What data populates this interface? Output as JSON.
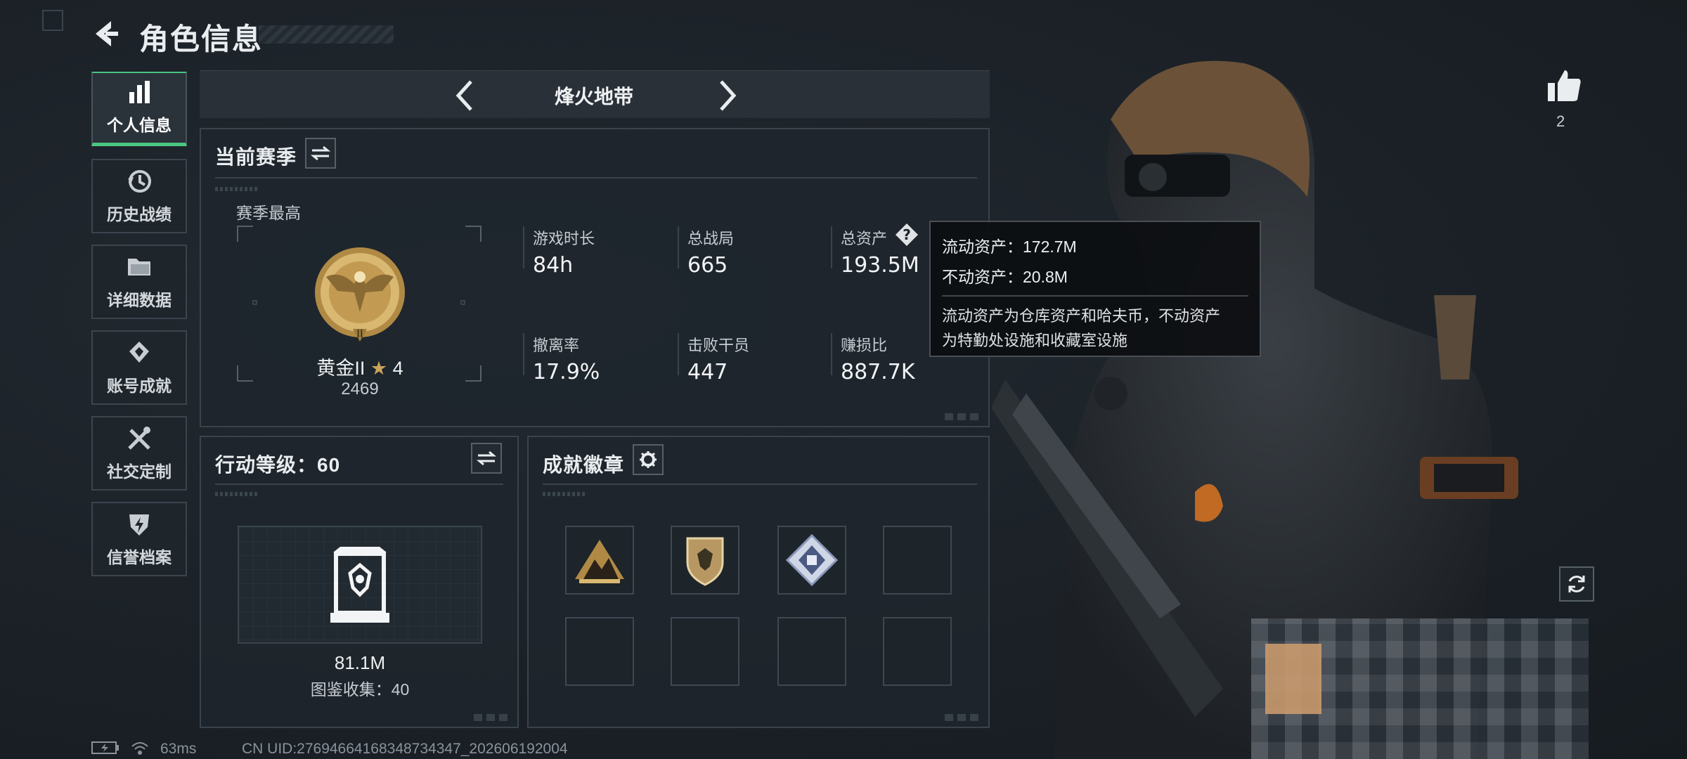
{
  "header": {
    "title": "角色信息"
  },
  "sidebar": {
    "items": [
      {
        "label": "个人信息",
        "icon": "bar-chart-icon",
        "active": true
      },
      {
        "label": "历史战绩",
        "icon": "history-clock-icon",
        "active": false
      },
      {
        "label": "详细数据",
        "icon": "folder-icon",
        "active": false
      },
      {
        "label": "账号成就",
        "icon": "achievement-icon",
        "active": false
      },
      {
        "label": "社交定制",
        "icon": "wrench-screwdriver-icon",
        "active": false
      },
      {
        "label": "信誉档案",
        "icon": "shield-lightning-icon",
        "active": false
      }
    ]
  },
  "mode": {
    "title": "烽火地带"
  },
  "season": {
    "title": "当前赛季",
    "best_label": "赛季最高",
    "rank_name": "黄金II",
    "rank_stars": "4",
    "rank_score": "2469",
    "stats": [
      {
        "label": "游戏时长",
        "value": "84h"
      },
      {
        "label": "总战局",
        "value": "665"
      },
      {
        "label": "总资产",
        "value": "193.5M"
      },
      {
        "label": "撤离率",
        "value": "17.9%"
      },
      {
        "label": "击败干员",
        "value": "447"
      },
      {
        "label": "赚损比",
        "value": "887.7K"
      }
    ]
  },
  "tooltip": {
    "liquid": "流动资产：172.7M",
    "fixed": "不动资产：20.8M",
    "desc1": "流动资产为仓库资产和哈夫币，不动资产",
    "desc2": "为特勤处设施和收藏室设施"
  },
  "action": {
    "title": "行动等级：60",
    "value": "81.1M",
    "collection": "图鉴收集：40"
  },
  "badges": {
    "title": "成就徽章",
    "slots": [
      "mountain-badge",
      "shield-badge",
      "diamond-badge",
      "",
      "",
      "",
      "",
      ""
    ]
  },
  "like": {
    "count": "2"
  },
  "footer": {
    "ping": "63ms",
    "uid": "CN UID:27694664168348734347_202606192004"
  },
  "colors": {
    "accent_green": "#49c783",
    "gold": "#c9a45a",
    "panel_border": "#3a434c"
  }
}
